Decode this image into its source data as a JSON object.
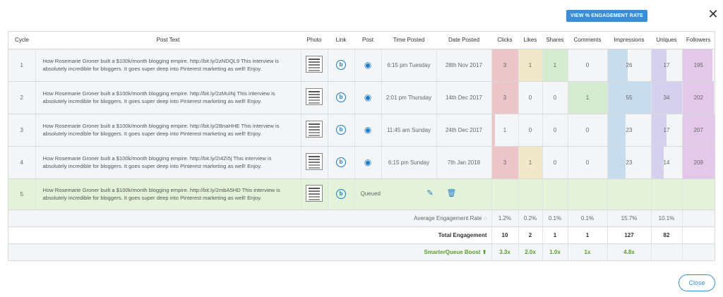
{
  "engagement_button": "VIEW % ENGAGEMENT RATE",
  "close_x": "✕",
  "close_button": "Close",
  "headers": [
    "Cycle",
    "Post Text",
    "Photo",
    "Link",
    "Post",
    "Time Posted",
    "Date Posted",
    "Clicks",
    "Likes",
    "Shares",
    "Comments",
    "Impressions",
    "Uniques",
    "Followers"
  ],
  "link_glyph": "b",
  "eye_glyph": "◉",
  "rows": [
    {
      "cycle": "1",
      "text": "How Rosemarie Groner built a $100k/month blogging empire. http://bit.ly/2zNDQL9 This interview is absolutely incredible for bloggers. It goes super deep into Pinterest marketing as well! Enjoy.",
      "time": "6:15 pm Tuesday",
      "date": "28th Nov 2017",
      "clicks": "3",
      "likes": "1",
      "shares": "1",
      "comments": "0",
      "impressions": "26",
      "uniques": "17",
      "followers": "195"
    },
    {
      "cycle": "2",
      "text": "How Rosemarie Groner built a $100k/month blogging empire. http://bit.ly/2zMuINj This interview is absolutely incredible for bloggers. It goes super deep into Pinterest marketing as well! Enjoy.",
      "time": "2:01 pm Thursday",
      "date": "14th Dec 2017",
      "clicks": "3",
      "likes": "0",
      "shares": "0",
      "comments": "1",
      "impressions": "55",
      "uniques": "34",
      "followers": "202"
    },
    {
      "cycle": "3",
      "text": "How Rosemarie Groner built a $100k/month blogging empire. http://bit.ly/2BnaHHE This interview is absolutely incredible for bloggers. It goes super deep into Pinterest marketing as well! Enjoy.",
      "time": "11:45 am Sunday",
      "date": "24th Dec 2017",
      "clicks": "1",
      "likes": "0",
      "shares": "0",
      "comments": "0",
      "impressions": "23",
      "uniques": "17",
      "followers": "207"
    },
    {
      "cycle": "4",
      "text": "How Rosemarie Groner built a $100k/month blogging empire. http://bit.ly/2I4Zi5j This interview is absolutely incredible for bloggers. It goes super deep into Pinterest marketing as well! Enjoy.",
      "time": "6:15 pm Sunday",
      "date": "7th Jan 2018",
      "clicks": "3",
      "likes": "1",
      "shares": "0",
      "comments": "0",
      "impressions": "23",
      "uniques": "14",
      "followers": "209"
    }
  ],
  "queued_row": {
    "cycle": "5",
    "text": "How Rosemarie Groner built a $100k/month blogging empire. http://bit.ly/2mbA5HD This interview is absolutely incredible for bloggers. It goes super deep into Pinterest marketing as well! Enjoy.",
    "status": "Queued",
    "edit_glyph": "✎",
    "trash_glyph": "🗑"
  },
  "average": {
    "label": "Average Engagement Rate",
    "values": [
      "1.2%",
      "0.2%",
      "0.1%",
      "0.1%",
      "15.7%",
      "10.1%",
      ""
    ]
  },
  "total": {
    "label": "Total Engagement",
    "values": [
      "10",
      "2",
      "1",
      "1",
      "127",
      "82",
      ""
    ]
  },
  "boost": {
    "label": "SmarterQueue Boost ⬆",
    "values": [
      "3.3x",
      "2.0x",
      "1.0x",
      "1x",
      "4.8x",
      "",
      ""
    ]
  },
  "colors": {
    "clicks": "#ecc5c8",
    "likes": "#f1e7c9",
    "shares": "#d5ebd0",
    "comments": "#d5ebd0",
    "impressions": "#c7dcec",
    "uniques": "#d5d0ee",
    "followers": "#e4c8ea",
    "accent": "#3a8ed8"
  },
  "fills": {
    "clicks": [
      1,
      1,
      0.12,
      1
    ],
    "likes": [
      1,
      0,
      0,
      1
    ],
    "shares": [
      1,
      0,
      0,
      0
    ],
    "comments": [
      0,
      1,
      0,
      0
    ],
    "impressions": [
      0.47,
      1,
      0.42,
      0.42
    ],
    "uniques": [
      0.5,
      1,
      0.5,
      0.41
    ],
    "followers": [
      0.93,
      0.97,
      0.99,
      1
    ]
  }
}
